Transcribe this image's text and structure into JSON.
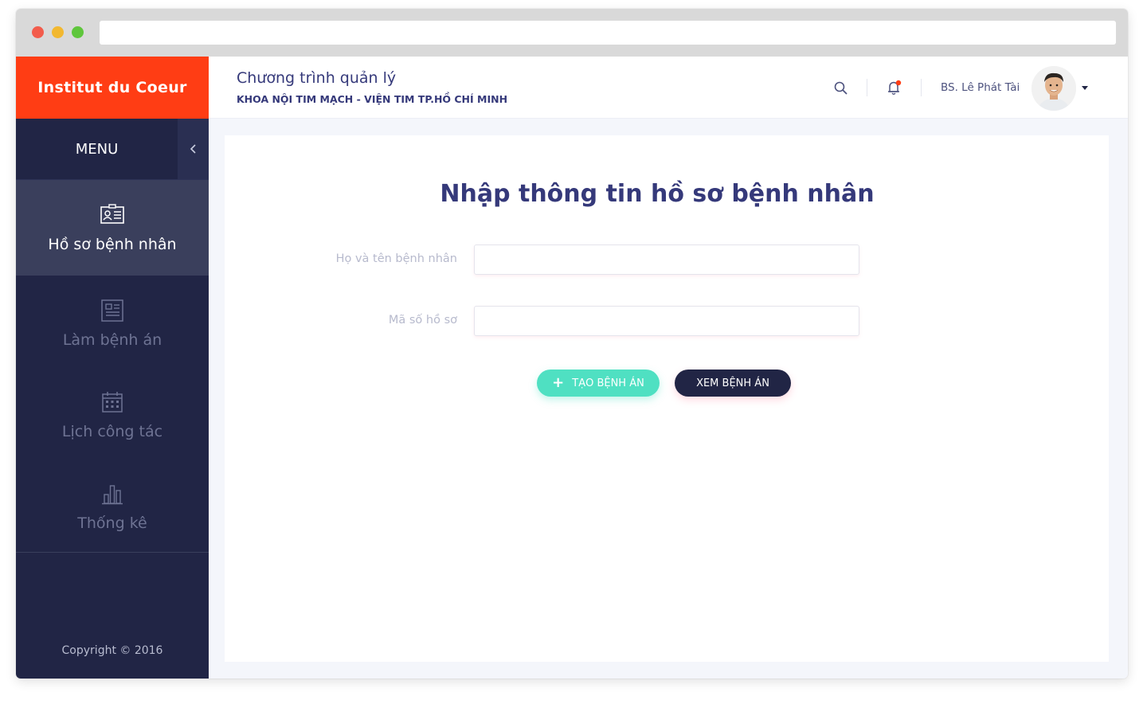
{
  "brand": {
    "name": "Institut du Coeur",
    "color": "#ff3d14"
  },
  "sidebar": {
    "menu_label": "MENU",
    "collapse_icon": "chevron-left-icon",
    "items": [
      {
        "label": "Hồ sơ bệnh nhân",
        "icon": "id-card-icon",
        "active": true
      },
      {
        "label": "Làm bệnh án",
        "icon": "document-icon",
        "active": false
      },
      {
        "label": "Lịch công tác",
        "icon": "calendar-icon",
        "active": false
      },
      {
        "label": "Thống kê",
        "icon": "bar-chart-icon",
        "active": false
      }
    ],
    "copyright": "Copyright © 2016"
  },
  "header": {
    "title": "Chương trình quản lý",
    "subtitle": "KHOA NỘI TIM MẠCH - VIỆN TIM TP.HỒ CHÍ MINH",
    "search_icon": "search-icon",
    "bell_icon": "bell-icon",
    "user_name": "BS. Lê Phát Tài",
    "dropdown_icon": "caret-down-icon"
  },
  "form": {
    "title": "Nhập thông tin hồ sơ bệnh nhân",
    "fields": [
      {
        "label": "Họ và tên bệnh nhân",
        "value": "",
        "placeholder": ""
      },
      {
        "label": "Mã số hồ sơ",
        "value": "",
        "placeholder": ""
      }
    ],
    "create_button": "TẠO BỆNH ÁN",
    "view_button": "XEM BỆNH ÁN"
  },
  "colors": {
    "sidebar_bg": "#212545",
    "accent_teal": "#4fe0c2",
    "title_navy": "#35397a",
    "notification_dot": "#ff3d14"
  }
}
